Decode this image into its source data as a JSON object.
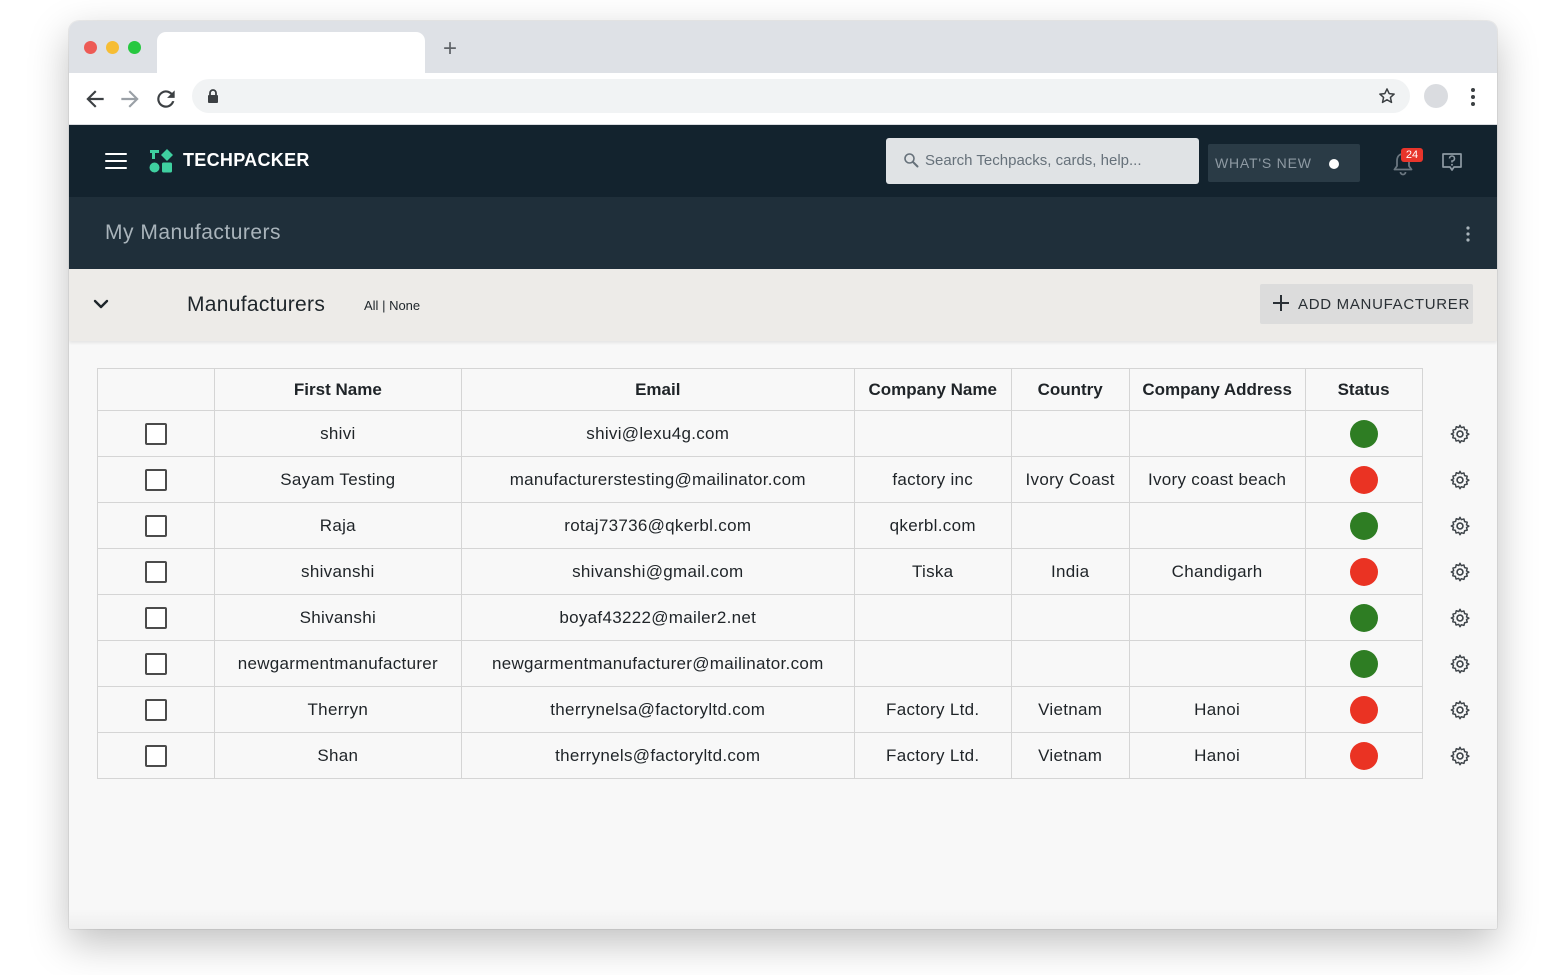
{
  "browser": {
    "tab_title": "",
    "new_tab_symbol": "+",
    "url": ""
  },
  "header": {
    "logo_text": "TECHPACKER",
    "search_placeholder": "Search Techpacks, cards, help...",
    "whats_new_label": "WHAT'S NEW",
    "notification_count": "24"
  },
  "subheader": {
    "title": "My Manufacturers"
  },
  "section": {
    "title": "Manufacturers",
    "select_all": "All",
    "separator": " | ",
    "select_none": "None",
    "add_button_label": "ADD MANUFACTURER"
  },
  "table": {
    "columns": [
      "",
      "First Name",
      "Email",
      "Company Name",
      "Country",
      "Company Address",
      "Status"
    ],
    "rows": [
      {
        "first_name": "shivi",
        "email": "shivi@lexu4g.com",
        "company": "",
        "country": "",
        "address": "",
        "status": "active"
      },
      {
        "first_name": "Sayam Testing",
        "email": "manufacturerstesting@mailinator.com",
        "company": "factory inc",
        "country": "Ivory Coast",
        "address": "Ivory coast beach",
        "status": "inactive"
      },
      {
        "first_name": "Raja",
        "email": "rotaj73736@qkerbl.com",
        "company": "qkerbl.com",
        "country": "",
        "address": "",
        "status": "active"
      },
      {
        "first_name": "shivanshi",
        "email": "shivanshi@gmail.com",
        "company": "Tiska",
        "country": "India",
        "address": "Chandigarh",
        "status": "inactive"
      },
      {
        "first_name": "Shivanshi",
        "email": "boyaf43222@mailer2.net",
        "company": "",
        "country": "",
        "address": "",
        "status": "active"
      },
      {
        "first_name": "newgarmentmanufacturer",
        "email": "newgarmentmanufacturer@mailinator.com",
        "company": "",
        "country": "",
        "address": "",
        "status": "active"
      },
      {
        "first_name": "Therryn",
        "email": "therrynelsa@factoryltd.com",
        "company": "Factory Ltd.",
        "country": "Vietnam",
        "address": "Hanoi",
        "status": "inactive"
      },
      {
        "first_name": "Shan",
        "email": "therrynels@factoryltd.com",
        "company": "Factory Ltd.",
        "country": "Vietnam",
        "address": "Hanoi",
        "status": "inactive"
      }
    ]
  },
  "colors": {
    "header_bg": "#13232e",
    "subheader_bg": "#1f2f3a",
    "status_active": "#2e7d23",
    "status_inactive": "#ea3323",
    "logo_accent": "#3fd0a0",
    "badge": "#e8352b"
  },
  "icons": {
    "menu": "hamburger-icon",
    "logo": "techpacker-logo-icon",
    "search": "magnifier-icon",
    "notifications": "bell-icon",
    "help": "help-chat-icon",
    "more": "vertical-dots-icon",
    "collapse": "chevron-down-icon",
    "add": "plus-icon",
    "row_settings": "gear-icon"
  }
}
